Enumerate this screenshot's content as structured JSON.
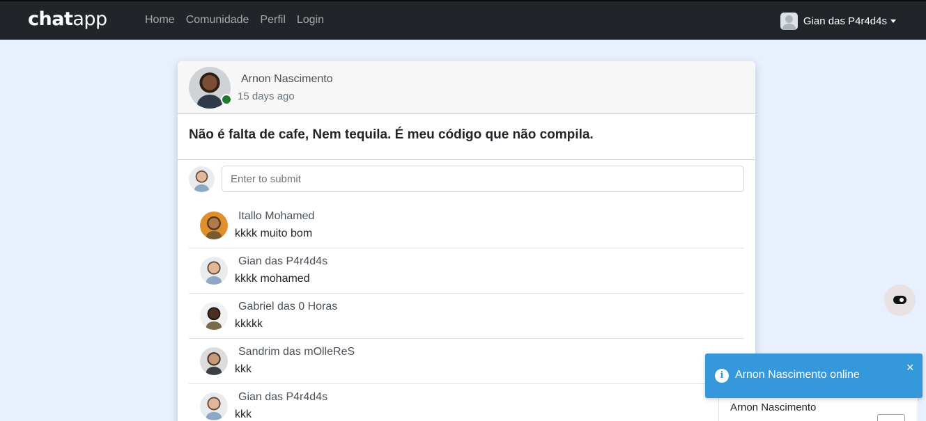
{
  "navbar": {
    "brand_bold": "chat",
    "brand_light": "app",
    "links": [
      "Home",
      "Comunidade",
      "Perfil",
      "Login"
    ],
    "user_name": "Gian das P4r4d4s"
  },
  "post": {
    "author": "Arnon Nascimento",
    "time": "15 days ago",
    "text": "Não é falta de cafe, Nem tequila. É meu código que não compila.",
    "comment_placeholder": "Enter to submit"
  },
  "comments": [
    {
      "name": "Itallo Mohamed",
      "text": "kkkk muito bom"
    },
    {
      "name": "Gian das P4r4d4s",
      "text": "kkkk mohamed"
    },
    {
      "name": "Gabriel das 0 Horas",
      "text": "kkkkk"
    },
    {
      "name": "Sandrim das mOlleReS",
      "text": "kkk"
    },
    {
      "name": "Gian das P4r4d4s",
      "text": "kkk"
    }
  ],
  "toast": {
    "message": "Arnon Nascimento online",
    "close_glyph": "×",
    "info_glyph": "i",
    "under_name": "Arnon Nascimento"
  },
  "colors": {
    "navbar": "#212529",
    "background": "#e8f0fe",
    "online": "#1e7a2e",
    "toast": "#3498db"
  }
}
